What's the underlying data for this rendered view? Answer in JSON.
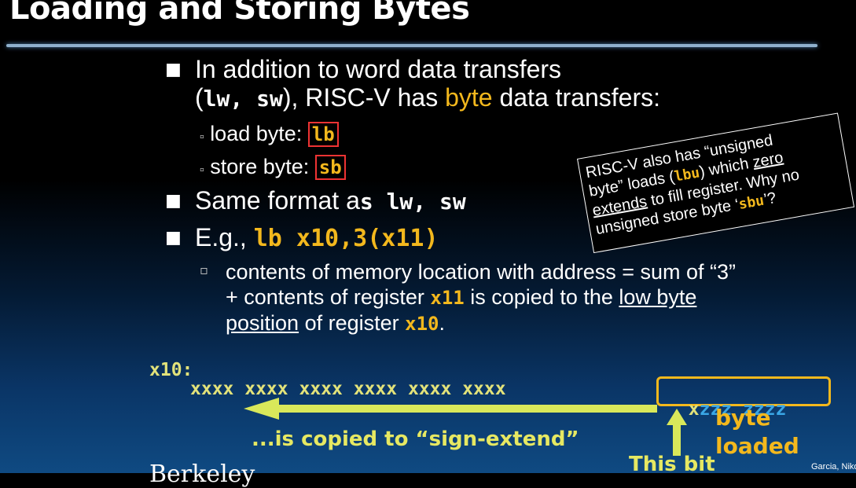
{
  "slide": {
    "title": "Loading and Storing Bytes",
    "footer": "Garcia, Nikolić",
    "cut_text": "Berkeley"
  },
  "bullets": {
    "b1_line1": "In addition to word data transfers",
    "b1_line2_pre": "(",
    "b1_line2_code": "lw, sw",
    "b1_line2_mid": "), RISC-V has ",
    "b1_line2_byte": "byte",
    "b1_line2_post": " data transfers:",
    "sub1_label": "load byte: ",
    "sub1_code": "lb",
    "sub2_label": "store byte: ",
    "sub2_code": "sb",
    "b2_text": "Same format a",
    "b2_code": "s lw, sw",
    "b3_text": "E.g., ",
    "b3_code": "lb x10,3(x11)",
    "sub3_l1": "contents of memory location with address = sum of “3”",
    "sub3_l2_pre": "+ contents of register ",
    "sub3_l2_code": "x11",
    "sub3_l2_post": " is copied to the ",
    "sub3_l2_u": "low byte",
    "sub3_l3_u": "position",
    "sub3_l3_mid": " of register ",
    "sub3_l3_code": "x10",
    "sub3_l3_post": "."
  },
  "note": {
    "l1": "RISC-V also has “unsigned",
    "l2_pre": "byte” loads (",
    "l2_code": "lbu",
    "l2_mid": ") which ",
    "l2_u": "zero",
    "l3_u": "extends",
    "l3_post": " to fill register.  Why no",
    "l4_pre": "unsigned store byte ‘",
    "l4_code": "sbu",
    "l4_post": "’?"
  },
  "diagram": {
    "reg_label": "x10:",
    "upper_bits": "xxxx xxxx xxxx xxxx xxxx xxxx",
    "byte_first": "x",
    "byte_rest": "zzz zzzz",
    "arrow_label": "...is copied to “sign-extend”",
    "this_bit": "This bit",
    "byte_loaded_1": "byte",
    "byte_loaded_2": "loaded"
  },
  "colors": {
    "accent_yellow": "#f3b81d",
    "arrow_green": "#d9e85a",
    "byte_blue": "#3aa7e6",
    "box_red": "#e33333",
    "rule_blue": "#8fb0cc"
  }
}
